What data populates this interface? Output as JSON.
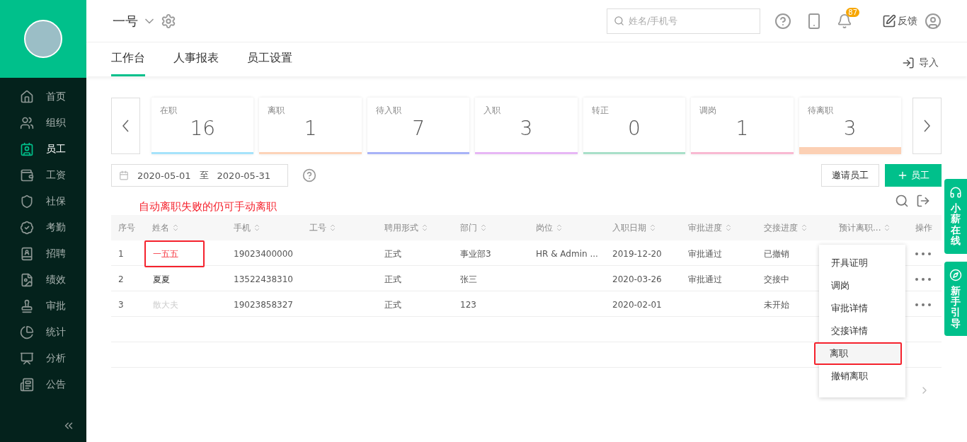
{
  "company": {
    "name": "一号"
  },
  "sidebar": {
    "items": [
      {
        "label": "首页",
        "selected": false
      },
      {
        "label": "组织",
        "selected": false
      },
      {
        "label": "员工",
        "selected": true
      },
      {
        "label": "工资",
        "selected": false
      },
      {
        "label": "社保",
        "selected": false
      },
      {
        "label": "考勤",
        "selected": false
      },
      {
        "label": "招聘",
        "selected": false
      },
      {
        "label": "绩效",
        "selected": false
      },
      {
        "label": "审批",
        "selected": false
      },
      {
        "label": "统计",
        "selected": false
      },
      {
        "label": "分析",
        "selected": false
      },
      {
        "label": "公告",
        "selected": false
      }
    ]
  },
  "header": {
    "search": {
      "placeholder": "姓名/手机号"
    },
    "notification_count": "87",
    "feedback": "反馈"
  },
  "tabs": [
    {
      "label": "工作台",
      "selected": true
    },
    {
      "label": "人事报表",
      "selected": false
    },
    {
      "label": "员工设置",
      "selected": false
    }
  ],
  "import_label": "导入",
  "stats": [
    {
      "label": "在职",
      "value": "16",
      "color": "#a6e3fb",
      "selected": false
    },
    {
      "label": "离职",
      "value": "1",
      "color": "#fdd3b8",
      "selected": false
    },
    {
      "label": "待入职",
      "value": "7",
      "color": "#a8b3f7",
      "selected": false
    },
    {
      "label": "入职",
      "value": "3",
      "color": "#e7b7f5",
      "selected": false
    },
    {
      "label": "转正",
      "value": "0",
      "color": "#a9e0c9",
      "selected": false
    },
    {
      "label": "调岗",
      "value": "1",
      "color": "#f9b9d2",
      "selected": false
    },
    {
      "label": "待离职",
      "value": "3",
      "color": "#fcd0b4",
      "selected": true
    }
  ],
  "date_range": {
    "start": "2020-05-01",
    "separator": "至",
    "end": "2020-05-31"
  },
  "buttons": [
    {
      "label": "邀请员工",
      "kind": "outline"
    },
    {
      "label": "员工",
      "kind": "primary"
    }
  ],
  "annotation": "自动离职失败的仍可手动离职",
  "table": {
    "columns": [
      {
        "label": "序号",
        "sortable": false
      },
      {
        "label": "姓名",
        "sortable": true
      },
      {
        "label": "手机",
        "sortable": true
      },
      {
        "label": "工号",
        "sortable": true
      },
      {
        "label": "聘用形式",
        "sortable": true
      },
      {
        "label": "部门",
        "sortable": true
      },
      {
        "label": "岗位",
        "sortable": true
      },
      {
        "label": "入职日期",
        "sortable": true
      },
      {
        "label": "审批进度",
        "sortable": true
      },
      {
        "label": "交接进度",
        "sortable": true
      },
      {
        "label": "预计离职...",
        "sortable": true
      },
      {
        "label": "操作",
        "sortable": false
      }
    ],
    "rows": [
      {
        "cells": [
          "1",
          "一五五",
          "19023400000",
          "",
          "正式",
          "事业部3",
          "HR & Admin ...",
          "2019-12-20",
          "审批通过",
          "已撤销",
          ""
        ],
        "annotated": true,
        "faded": false
      },
      {
        "cells": [
          "2",
          "夏夏",
          "13522438310",
          "",
          "正式",
          "张三",
          "",
          "2020-03-26",
          "审批通过",
          "交接中",
          ""
        ],
        "annotated": false,
        "faded": false
      },
      {
        "cells": [
          "3",
          "散大夫",
          "19023858327",
          "",
          "正式",
          "123",
          "",
          "2020-02-01",
          "",
          "未开始",
          ""
        ],
        "annotated": false,
        "faded": true
      }
    ]
  },
  "action_menu": {
    "items": [
      {
        "label": "开具证明",
        "annotated": false
      },
      {
        "label": "调岗",
        "annotated": false
      },
      {
        "label": "审批详情",
        "annotated": false
      },
      {
        "label": "交接详情",
        "annotated": false
      },
      {
        "label": "离职",
        "annotated": true
      },
      {
        "label": "撤销离职",
        "annotated": false
      }
    ]
  },
  "side_tabs": [
    {
      "label": "小薪在线"
    },
    {
      "label": "新手引导"
    }
  ]
}
